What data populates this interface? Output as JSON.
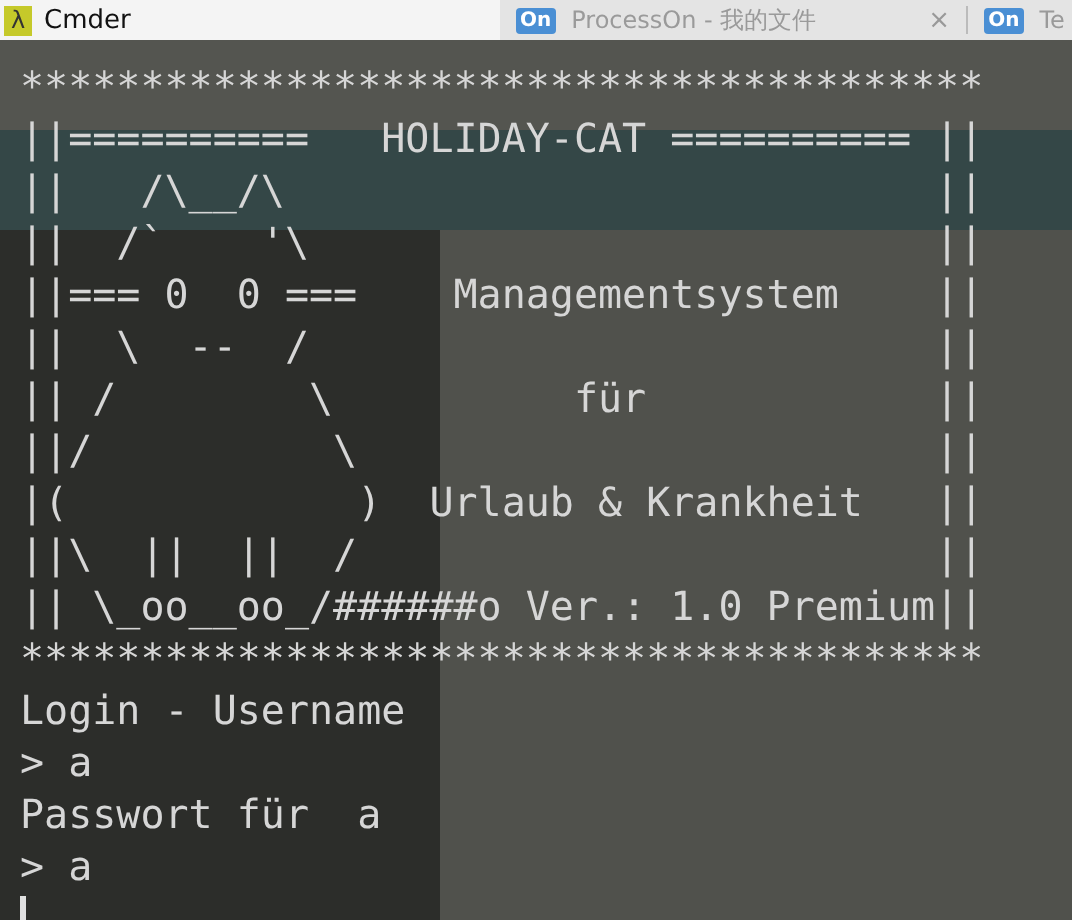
{
  "window": {
    "icon_glyph": "λ",
    "title": "Cmder"
  },
  "browser": {
    "tabs": [
      {
        "badge": "On",
        "title": "ProcessOn - 我的文件",
        "close": "×"
      },
      {
        "badge": "On",
        "title": "Te"
      }
    ]
  },
  "terminal": {
    "lines": [
      "****************************************",
      "||==========   HOLIDAY-CAT ========== ||",
      "||   /\\__/\\                           ||",
      "||  /`    '\\                          ||",
      "||=== 0  0 ===    Managementsystem    ||",
      "||  \\  --  /                          ||",
      "|| /        \\          für            ||",
      "||/          \\                        ||",
      "|(            )  Urlaub & Krankheit   ||",
      "||\\  ||  ||  /                        ||",
      "|| \\_oo__oo_/######o Ver.: 1.0 Premium||",
      "****************************************",
      "Login - Username",
      "> a",
      "Passwort für  a",
      "> a"
    ],
    "cursor": true
  }
}
